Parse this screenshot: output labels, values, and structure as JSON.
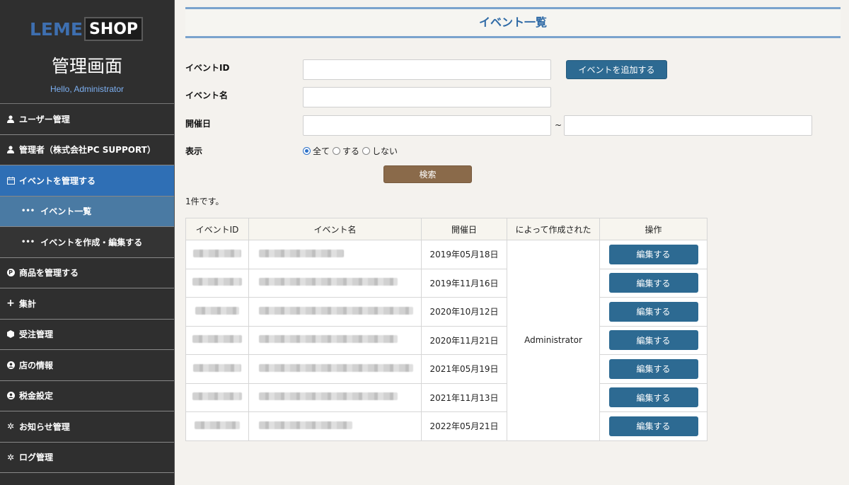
{
  "logo": {
    "part1": "LEME",
    "part2": "SHOP"
  },
  "sidebar": {
    "title": "管理画面",
    "hello": "Hello, Administrator",
    "items": [
      {
        "label": "ユーザー管理",
        "icon": "user-icon"
      },
      {
        "label": "管理者（株式会社PC SUPPORT）",
        "icon": "user-icon"
      },
      {
        "label": "イベントを管理する",
        "icon": "calendar-icon"
      },
      {
        "label": "イベント一覧",
        "icon": "dots-icon"
      },
      {
        "label": "イベントを作成・編集する",
        "icon": "dots-icon"
      },
      {
        "label": "商品を管理する",
        "icon": "product-icon"
      },
      {
        "label": "集計",
        "icon": "plus-icon"
      },
      {
        "label": "受注管理",
        "icon": "box-icon"
      },
      {
        "label": "店の情報",
        "icon": "account-icon"
      },
      {
        "label": "税金設定",
        "icon": "account-icon"
      },
      {
        "label": "お知らせ管理",
        "icon": "gear-icon"
      },
      {
        "label": "ログ管理",
        "icon": "gear-icon"
      }
    ]
  },
  "header": {
    "title": "イベント一覧"
  },
  "form": {
    "event_id_label": "イベントID",
    "event_name_label": "イベント名",
    "date_label": "開催日",
    "date_separator": "~",
    "display_label": "表示",
    "radio_all": "全て",
    "radio_yes": "する",
    "radio_no": "しない",
    "add_button": "イベントを追加する",
    "search_button": "検索"
  },
  "result_count": "1件です。",
  "table": {
    "headers": [
      "イベントID",
      "イベント名",
      "開催日",
      "によって作成された",
      "操作"
    ],
    "rows": [
      {
        "date": "2019年05月18日",
        "action": "編集する"
      },
      {
        "date": "2019年11月16日",
        "action": "編集する"
      },
      {
        "date": "2020年10月12日",
        "action": "編集する"
      },
      {
        "date": "2020年11月21日",
        "action": "編集する"
      },
      {
        "date": "2021年05月19日",
        "action": "編集する"
      },
      {
        "date": "2021年11月13日",
        "action": "編集する"
      },
      {
        "date": "2022年05月21日",
        "action": "編集する"
      }
    ],
    "created_by": "Administrator"
  },
  "colors": {
    "accent": "#2f6fb5",
    "button": "#2d6a92",
    "search": "#8a6a4a"
  }
}
